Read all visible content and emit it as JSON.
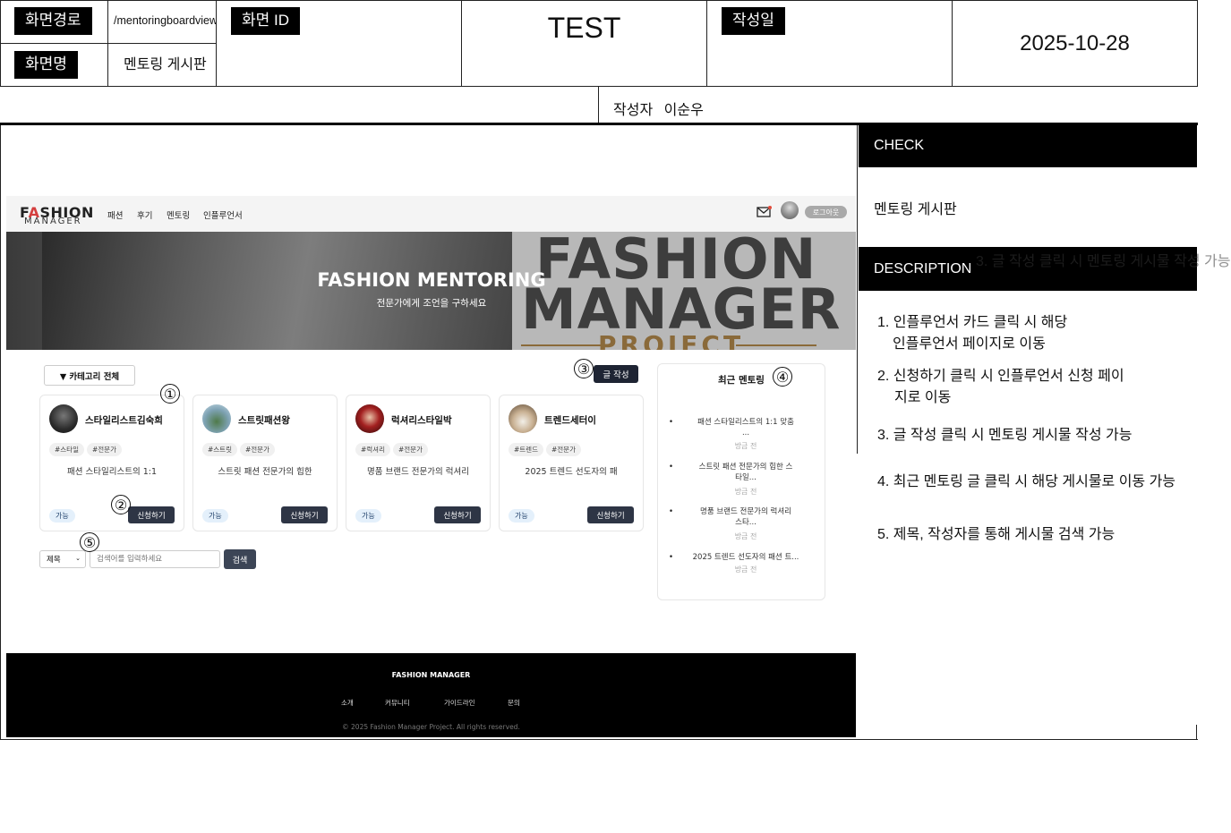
{
  "header": {
    "path_label": "화면경로",
    "path_value": "/mentoringboardview",
    "name_label": "화면명",
    "name_value": "멘토링 게시판",
    "id_label": "화면 ID",
    "test_label": "TEST",
    "date_label": "작성일",
    "date_value": "2025-10-28",
    "author_label": "작성자",
    "author_value": "이순우"
  },
  "panel": {
    "check_title": "CHECK",
    "check_text": "멘토링 게시판",
    "desc_title": "DESCRIPTION",
    "overflow_text": "3. 글 작성 클릭 시 멘토링 게시물 작성 가능",
    "items": [
      "1. 인플루언서 카드 클릭 시 해당 인플루언서 페이지로 이동",
      "2. 신청하기 클릭 시 인플루언서 신청 페이지로 이동",
      "3. 글 작성 클릭 시 멘토링 게시물 작성 가능",
      "4. 최근 멘토링 글 클릭 시 해당 게시물로 이동 가능",
      "5. 제목, 작성자를 통해 게시물 검색 가능"
    ],
    "item1_line1": "1. 인플루언서 카드 클릭 시 해당",
    "item1_line2": "인플루언서 페이지로 이동",
    "item2_line1": "2. 신청하기 클릭 시 인플루언서 신청 페이",
    "item2_line2": "지로 이동"
  },
  "site": {
    "logo_main": "FASHION",
    "logo_sub": "MANAGER",
    "nav": [
      "패션",
      "후기",
      "멘토링",
      "인플루언서"
    ],
    "logout": "로그아웃",
    "hero_title": "FASHION MENTORING",
    "hero_subtitle": "전문가에게 조언을 구하세요",
    "hero_bg_line1": "FASHION",
    "hero_bg_line2": "MANAGER",
    "hero_bg_line3": "PROJECT",
    "category": "▼ 카테고리 전체",
    "write": "글 작성",
    "cards": [
      {
        "name": "스타일리스트김숙희",
        "tags": [
          "#스타일",
          "#전문가"
        ],
        "desc": "패션 스타일리스트의 1:1",
        "status": "가능",
        "apply": "신청하기",
        "avatar_color": "#2b2b2b"
      },
      {
        "name": "스트릿패션왕",
        "tags": [
          "#스트릿",
          "#전문가"
        ],
        "desc": "스트릿 패션 전문가의 힙한",
        "status": "가능",
        "apply": "신청하기",
        "avatar_color": "#7fa3b5"
      },
      {
        "name": "럭셔리스타일박",
        "tags": [
          "#럭셔리",
          "#전문가"
        ],
        "desc": "명품 브랜드 전문가의 럭셔리",
        "status": "가능",
        "apply": "신청하기",
        "avatar_color": "#8a1a1a"
      },
      {
        "name": "트렌드세터이",
        "tags": [
          "#트렌드",
          "#전문가"
        ],
        "desc": "2025 트렌드 선도자의 패",
        "status": "가능",
        "apply": "신청하기",
        "avatar_color": "#b89a78"
      }
    ],
    "recent_title": "최근 멘토링",
    "recent": [
      {
        "lines": [
          "패션 스타일리스트의 1:1 맞춤",
          "..."
        ],
        "state": "방금 전"
      },
      {
        "lines": [
          "스트릿 패션 전문가의 힙한 스",
          "타일..."
        ],
        "state": "방금 전"
      },
      {
        "lines": [
          "명품 브랜드 전문가의 럭셔리",
          "스타..."
        ],
        "state": "방금 전"
      },
      {
        "lines": [
          "2025 트렌드 선도자의 패션 트..."
        ],
        "state": "방금 전"
      }
    ],
    "search_type": "제목",
    "search_placeholder": "검색어를 입력하세요",
    "search_button": "검색",
    "footer_brand": "FASHION MANAGER",
    "footer_links": [
      "소개",
      "커뮤니티",
      "가이드라인",
      "문의"
    ],
    "footer_copy": "© 2025 Fashion Manager Project. All rights reserved."
  },
  "markers": [
    "①",
    "②",
    "③",
    "④",
    "⑤"
  ]
}
